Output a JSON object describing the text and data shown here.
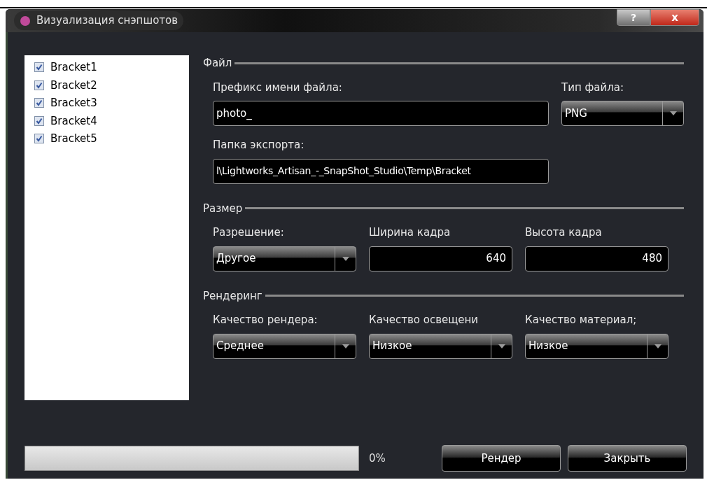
{
  "window": {
    "title": "Визуализация снэпшотов",
    "help": "?",
    "close": "x"
  },
  "brackets": [
    {
      "label": "Bracket1",
      "checked": true
    },
    {
      "label": "Bracket2",
      "checked": true
    },
    {
      "label": "Bracket3",
      "checked": true
    },
    {
      "label": "Bracket4",
      "checked": true
    },
    {
      "label": "Bracket5",
      "checked": true
    }
  ],
  "file": {
    "title": "Файл",
    "prefix_label": "Префикс имени файла:",
    "prefix_value": "photo_",
    "type_label": "Тип файла:",
    "type_value": "PNG",
    "folder_label": "Папка экспорта:",
    "folder_value": "l\\Lightworks_Artisan_-_SnapShot_Studio\\Temp\\Bracket"
  },
  "size": {
    "title": "Размер",
    "fields": [
      {
        "kind": "dropdown",
        "label": "Разрешение:",
        "value": "Другое"
      },
      {
        "kind": "number",
        "label": "Ширина кадра",
        "value": "640"
      },
      {
        "kind": "number",
        "label": "Высота кадра",
        "value": "480"
      }
    ]
  },
  "rendering": {
    "title": "Рендеринг",
    "fields": [
      {
        "kind": "dropdown",
        "label": "Качество рендера:",
        "value": "Среднее"
      },
      {
        "kind": "dropdown",
        "label": "Качество освещени",
        "value": "Низкое"
      },
      {
        "kind": "dropdown",
        "label": "Качество материал;",
        "value": "Низкое"
      }
    ]
  },
  "progress": {
    "level": 0,
    "reading": "0%"
  },
  "buttons": [
    "Рендер",
    "Закрыть"
  ]
}
